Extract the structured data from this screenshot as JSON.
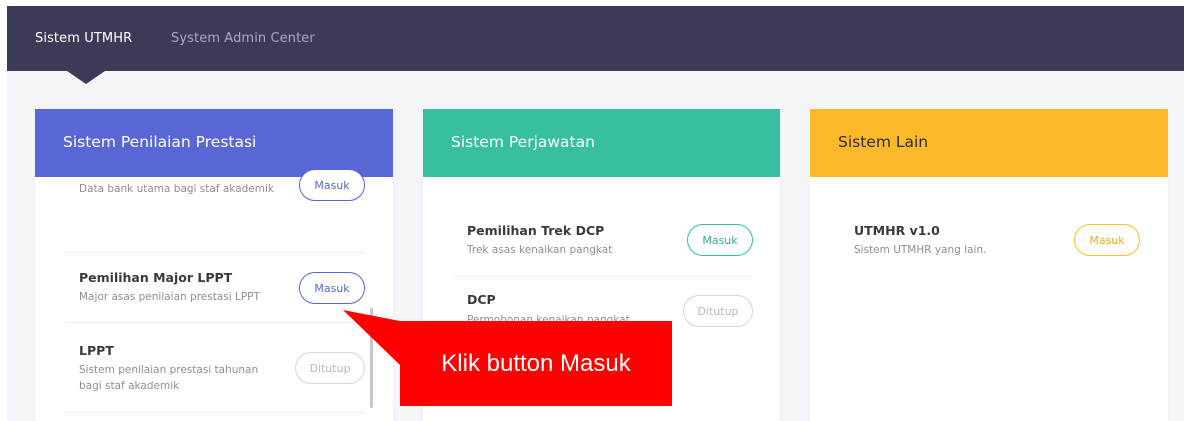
{
  "nav": {
    "active_label": "Sistem UTMHR",
    "admin_label": "System Admin Center",
    "bar_color": "#3c3b57"
  },
  "cards": [
    {
      "title": "Sistem Penilaian Prestasi",
      "header_color": "#5966d6",
      "items": [
        {
          "title": "",
          "description": "Data bank utama bagi staf akademik",
          "button": "Masuk",
          "button_state": "open"
        },
        {
          "title": "Pemilihan Major LPPT",
          "description": "Major asas penilaian prestasi LPPT",
          "button": "Masuk",
          "button_state": "open"
        },
        {
          "title": "LPPT",
          "description": "Sistem penilaian prestasi tahunan bagi staf akademik",
          "button": "Ditutup",
          "button_state": "closed"
        }
      ]
    },
    {
      "title": "Sistem Perjawatan",
      "header_color": "#37bfa0",
      "items": [
        {
          "title": "Pemilihan Trek DCP",
          "description": "Trek asas kenaikan pangkat",
          "button": "Masuk",
          "button_state": "open"
        },
        {
          "title": "DCP",
          "description": "Permohonan kenaikan pangkat",
          "button": "Ditutup",
          "button_state": "closed"
        }
      ]
    },
    {
      "title": "Sistem Lain",
      "header_color": "#fcba2b",
      "items": [
        {
          "title": "UTMHR v1.0",
          "description": "Sistem UTMHR yang lain.",
          "button": "Masuk",
          "button_state": "open"
        }
      ]
    }
  ],
  "callout": {
    "text": "Klik button Masuk",
    "color": "#ff0000"
  }
}
